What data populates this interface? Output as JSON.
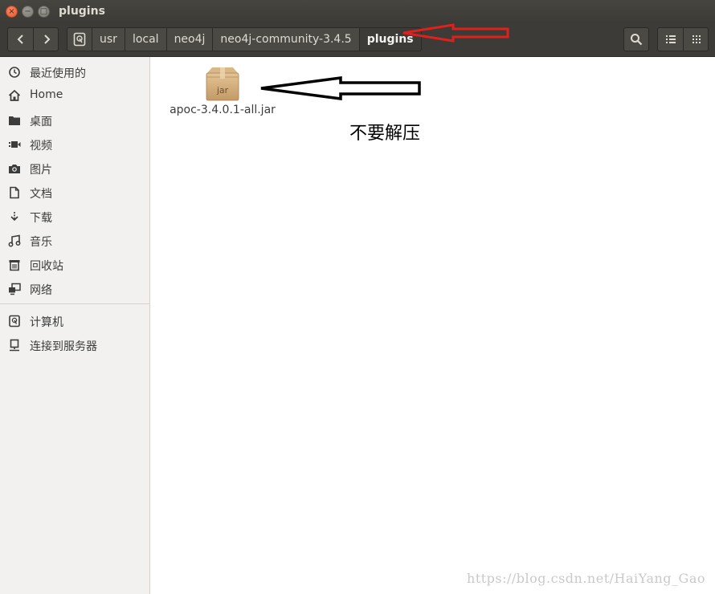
{
  "window": {
    "title": "plugins",
    "close_glyph": "×",
    "min_glyph": "−",
    "max_glyph": "□"
  },
  "toolbar": {
    "back_icon": "chevron-left-icon",
    "forward_icon": "chevron-right-icon",
    "root_icon": "drive-icon",
    "breadcrumbs": [
      {
        "label": "usr"
      },
      {
        "label": "local"
      },
      {
        "label": "neo4j"
      },
      {
        "label": "neo4j-community-3.4.5"
      },
      {
        "label": "plugins"
      }
    ],
    "search_icon": "search-icon",
    "list_view_icon": "list-view-icon",
    "grid_view_icon": "grid-view-icon"
  },
  "sidebar": {
    "items": [
      {
        "label": "最近使用的",
        "icon": "clock-icon"
      },
      {
        "label": "Home",
        "icon": "home-icon"
      },
      {
        "label": "桌面",
        "icon": "folder-icon"
      },
      {
        "label": "视频",
        "icon": "video-icon"
      },
      {
        "label": "图片",
        "icon": "camera-icon"
      },
      {
        "label": "文档",
        "icon": "document-icon"
      },
      {
        "label": "下载",
        "icon": "download-icon"
      },
      {
        "label": "音乐",
        "icon": "music-icon"
      },
      {
        "label": "回收站",
        "icon": "trash-icon"
      },
      {
        "label": "网络",
        "icon": "network-icon"
      }
    ],
    "devices": [
      {
        "label": "计算机",
        "icon": "computer-icon"
      },
      {
        "label": "连接到服务器",
        "icon": "server-icon"
      }
    ]
  },
  "files": [
    {
      "name": "apoc-3.4.0.1-all.jar",
      "icon_text": "jar",
      "icon": "jar-package-icon"
    }
  ],
  "annotation": {
    "text": "不要解压",
    "red_arrow_color": "#e0201b",
    "black_arrow_color": "#000000"
  },
  "watermark": "https://blog.csdn.net/HaiYang_Gao",
  "colors": {
    "titlebar": "#3b3a36",
    "toolbar": "#3c3b37",
    "sidebar": "#f2f1f0",
    "main": "#ffffff"
  }
}
